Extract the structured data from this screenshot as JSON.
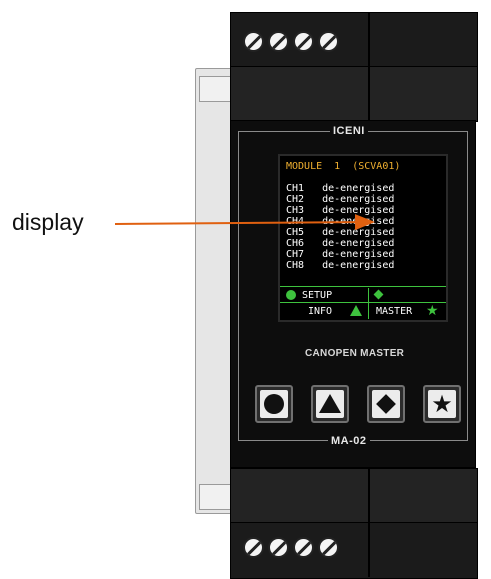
{
  "callout": {
    "label": "display",
    "line_color": "#e06010"
  },
  "panel": {
    "brand": "ICENI",
    "subtitle": "CANOPEN MASTER",
    "model": "MA-02"
  },
  "lcd": {
    "header": "MODULE  1  (SCVA01)",
    "channels": [
      {
        "name": "CH1",
        "status": "de-energised"
      },
      {
        "name": "CH2",
        "status": "de-energised"
      },
      {
        "name": "CH3",
        "status": "de-energised"
      },
      {
        "name": "CH4",
        "status": "de-energised"
      },
      {
        "name": "CH5",
        "status": "de-energised"
      },
      {
        "name": "CH6",
        "status": "de-energised"
      },
      {
        "name": "CH7",
        "status": "de-energised"
      },
      {
        "name": "CH8",
        "status": "de-energised"
      }
    ],
    "softkeys": {
      "setup": "SETUP",
      "info": "INFO",
      "master": "MASTER"
    },
    "colors": {
      "header": "#f0b030",
      "softkey": "#3ec23e"
    }
  },
  "buttons": [
    {
      "icon": "circle-icon"
    },
    {
      "icon": "triangle-icon"
    },
    {
      "icon": "diamond-icon"
    },
    {
      "icon": "star-icon"
    }
  ]
}
